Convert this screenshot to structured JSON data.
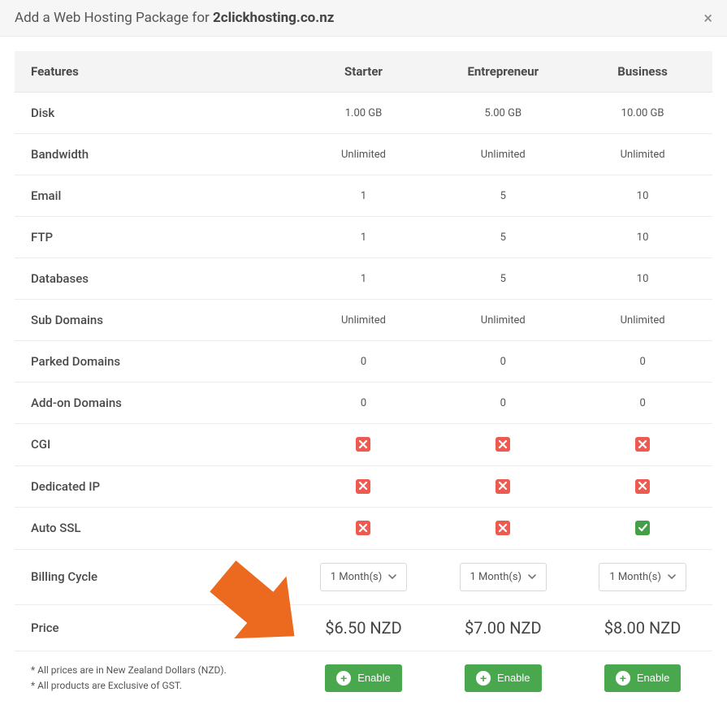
{
  "header": {
    "title_prefix": "Add a Web Hosting Package for ",
    "domain": "2clickhosting.co.nz"
  },
  "columns": {
    "features": "Features",
    "plan0": "Starter",
    "plan1": "Entrepreneur",
    "plan2": "Business"
  },
  "rows": [
    {
      "label": "Disk",
      "values": [
        "1.00 GB",
        "5.00 GB",
        "10.00 GB"
      ]
    },
    {
      "label": "Bandwidth",
      "values": [
        "Unlimited",
        "Unlimited",
        "Unlimited"
      ]
    },
    {
      "label": "Email",
      "values": [
        "1",
        "5",
        "10"
      ]
    },
    {
      "label": "FTP",
      "values": [
        "1",
        "5",
        "10"
      ]
    },
    {
      "label": "Databases",
      "values": [
        "1",
        "5",
        "10"
      ]
    },
    {
      "label": "Sub Domains",
      "values": [
        "Unlimited",
        "Unlimited",
        "Unlimited"
      ]
    },
    {
      "label": "Parked Domains",
      "values": [
        "0",
        "0",
        "0"
      ]
    },
    {
      "label": "Add-on Domains",
      "values": [
        "0",
        "0",
        "0"
      ]
    },
    {
      "label": "CGI",
      "values": [
        "x",
        "x",
        "x"
      ]
    },
    {
      "label": "Dedicated IP",
      "values": [
        "x",
        "x",
        "x"
      ]
    },
    {
      "label": "Auto SSL",
      "values": [
        "x",
        "x",
        "v"
      ]
    }
  ],
  "billing": {
    "label": "Billing Cycle",
    "options": [
      "1 Month(s)",
      "1 Month(s)",
      "1 Month(s)"
    ]
  },
  "price": {
    "label": "Price",
    "values": [
      "$6.50 NZD",
      "$7.00 NZD",
      "$8.00 NZD"
    ]
  },
  "footer": {
    "note1": "* All prices are in New Zealand Dollars (NZD).",
    "note2": "* All products are Exclusive of GST.",
    "enable_label": "Enable"
  }
}
